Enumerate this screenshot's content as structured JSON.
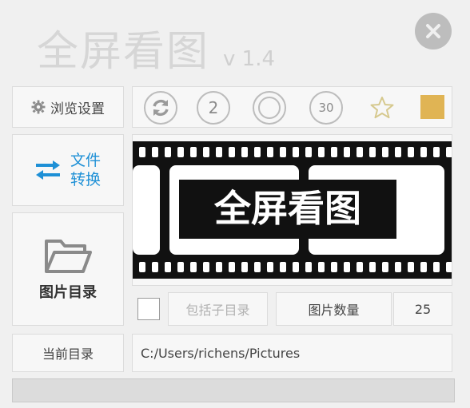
{
  "app": {
    "title": "全屏看图",
    "version": "v 1.4"
  },
  "buttons": {
    "browse_settings": "浏览设置",
    "convert_files": "文件转换",
    "picture_dir": "图片目录"
  },
  "toolbar": {
    "refresh_icon": "refresh-icon",
    "interval_2": "2",
    "interval_30": "30",
    "star_icon": "star-icon",
    "color_swatch": "#e0b454"
  },
  "preview": {
    "logo_text": "全屏看图"
  },
  "options": {
    "include_subdirs": "包括子目录",
    "include_subdirs_checked": false,
    "picture_count_label": "图片数量",
    "picture_count": "25"
  },
  "current_dir": {
    "label": "当前目录",
    "path": "C:/Users/richens/Pictures"
  },
  "progress": {
    "value": 0
  }
}
